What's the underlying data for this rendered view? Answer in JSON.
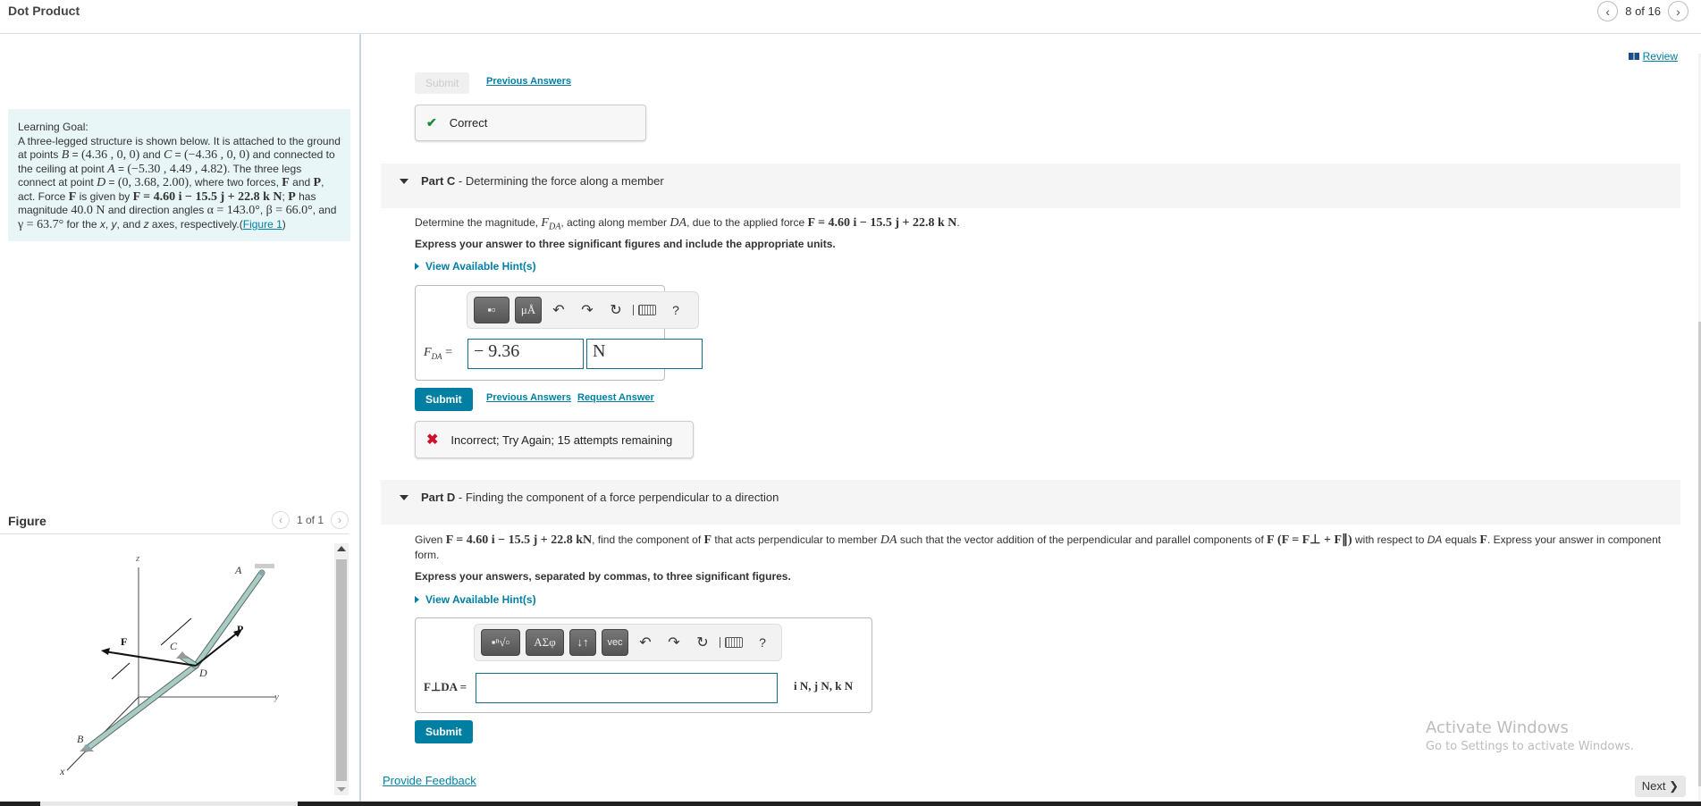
{
  "header": {
    "title": "Dot Product",
    "pager": {
      "text": "8 of 16",
      "prev_icon": "chevron-left-icon",
      "next_icon": "chevron-right-icon"
    }
  },
  "left": {
    "goal": {
      "heading": "Learning Goal:",
      "t1": "A three-legged structure is shown below. It is attached to the ground at points ",
      "B": "B",
      "eq": " = ",
      "B_val": "(4.36 , 0, 0)",
      "and": "  and ",
      "C": "C",
      "C_val": "(−4.36 , 0, 0)",
      "t2": " and connected to the ceiling at point ",
      "A": "A",
      "A_val": "(−5.30 , 4.49 , 4.82)",
      "t3": ". The three legs connect at point ",
      "D": "D",
      "D_val": "(0, 3.68, 2.00)",
      "t4": ", where two forces, ",
      "F": "F",
      "and2": " and ",
      "P": "P",
      "t5": ", act. Force ",
      "t6": " is given by ",
      "F_expr": "F = 4.60 i − 15.5 j + 22.8 k N",
      "t7": "; ",
      "t8": " has magnitude ",
      "P_mag": "40.0 N",
      "t9": " and direction angles ",
      "alpha": "α = 143.0°",
      "beta": "β = 66.0°",
      "t10": ", and ",
      "gamma": "γ = 63.7°",
      "t11": " for the ",
      "x": "x",
      "y": "y",
      "z": "z",
      "t12": " axes, respectively.",
      "figure_link": "Figure 1",
      "comma": ", ",
      "comma_and": ", and ",
      "lparen": "(",
      "rparen": ")"
    },
    "figure": {
      "title": "Figure",
      "pager": "1 of 1",
      "labels": {
        "z": "z",
        "y": "y",
        "x": "x",
        "A": "A",
        "B": "B",
        "C": "C",
        "D": "D",
        "F": "F",
        "P": "P"
      }
    }
  },
  "main": {
    "review": "Review",
    "partB": {
      "submit": "Submit",
      "previous_answers": "Previous Answers",
      "feedback": "Correct"
    },
    "partC": {
      "label_bold": "Part C",
      "label_rest": " - Determining the force along a member",
      "q1": "Determine the magnitude, ",
      "F_DA": "F",
      "F_DA_sub": "DA",
      "q2": ", acting along member ",
      "DA": "DA",
      "q3": ", due to the applied force ",
      "F_expr": "F = 4.60 i − 15.5 j + 22.8 k N",
      "q4": ".",
      "instruction": "Express your answer to three significant figures and include the appropriate units.",
      "hint": "View Available Hint(s)",
      "toolbar": {
        "templates": "▪▫",
        "units": "μÅ",
        "undo": "↶",
        "redo": "↷",
        "reset": "↻",
        "help": "?"
      },
      "answer_label_main": "F",
      "answer_label_sub": "DA",
      "answer_equals": " =",
      "value": "− 9.36",
      "unit": "N",
      "submit": "Submit",
      "previous_answers": "Previous Answers",
      "request_answer": "Request Answer",
      "feedback": "Incorrect; Try Again; 15 attempts remaining"
    },
    "partD": {
      "label_bold": "Part D",
      "label_rest": " - Finding the component of a force perpendicular to a direction",
      "q1": "Given ",
      "F_expr": "F = 4.60 i  − 15.5 j  + 22.8 kN",
      "q2": ", find the component of ",
      "F": "F",
      "q3": " that acts perpendicular to member ",
      "DA": "DA",
      "q4": " such that the vector addition of the perpendicular and parallel components of ",
      "F_sum": "(F = F⊥ + F∥)",
      "q5": " with respect to ",
      "DA_it": "DA",
      "q6": " equals ",
      "q7": ". Express your answer in component form.",
      "instruction": "Express your answers, separated by commas, to three significant figures.",
      "hint": "View Available Hint(s)",
      "toolbar": {
        "templates": "▪ⁿ√▫",
        "symbols": "ΑΣφ",
        "arrows": "↓↑",
        "vec": "vec",
        "undo": "↶",
        "redo": "↷",
        "reset": "↻",
        "help": "?"
      },
      "answer_label": "F⊥DA =",
      "value": "",
      "units_suffix": "i N, j N, k N",
      "submit": "Submit"
    },
    "provide_feedback": "Provide Feedback",
    "next": "Next ❯"
  },
  "overlay": {
    "activate_title": "Activate Windows",
    "activate_sub": "Go to Settings to activate Windows."
  },
  "colors": {
    "accent": "#007fa3",
    "correct": "#1f8b3a",
    "incorrect": "#d0102b",
    "goal_bg": "#e8f6f7"
  }
}
